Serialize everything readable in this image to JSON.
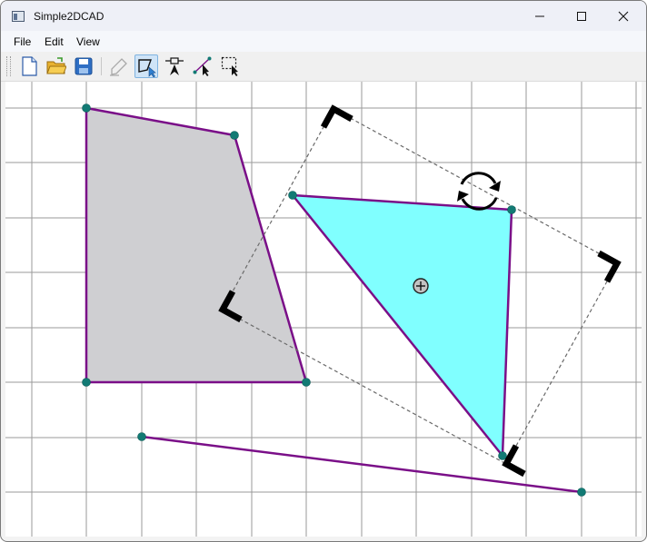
{
  "window": {
    "title": "Simple2DCAD"
  },
  "controls": {
    "minimize": "minimize-icon",
    "maximize": "maximize-icon",
    "close": "close-icon"
  },
  "menu": {
    "items": [
      "File",
      "Edit",
      "View"
    ]
  },
  "toolbar": {
    "buttons": [
      {
        "name": "new-file",
        "icon": "new-file-icon"
      },
      {
        "name": "open-folder",
        "icon": "open-folder-icon"
      },
      {
        "name": "save",
        "icon": "save-icon"
      },
      {
        "name": "pencil",
        "icon": "pencil-icon",
        "disabled": true
      },
      {
        "name": "polygon",
        "icon": "polygon-select-icon",
        "active": true
      },
      {
        "name": "point",
        "icon": "point-tool-icon"
      },
      {
        "name": "line",
        "icon": "line-tool-icon"
      },
      {
        "name": "rect-select",
        "icon": "rect-select-icon"
      }
    ]
  },
  "colors": {
    "outline": "#7a0f88",
    "vertex": "#127a74",
    "quad_fill": "#cfcfd2",
    "triangle_fill": "#80ffff",
    "grid": "#9a9a9a",
    "selection": "#6a6a6a",
    "handle": "#000000",
    "active_tool": "#cfe4f7"
  }
}
